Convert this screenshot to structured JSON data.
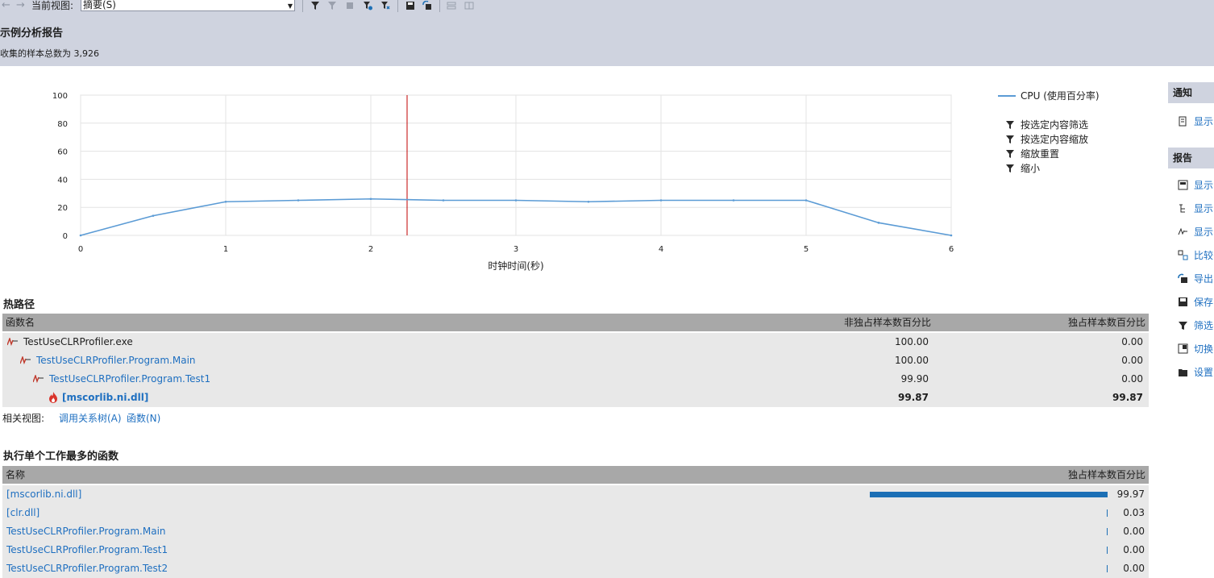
{
  "toolbar": {
    "view_label": "当前视图:",
    "view_value": "摘要(S)"
  },
  "header": {
    "title": "示例分析报告",
    "subtitle": "收集的样本总数为 3,926"
  },
  "chart_data": {
    "type": "line",
    "xlabel": "时钟时间(秒)",
    "ylabel": "",
    "xlim": [
      0,
      6
    ],
    "ylim": [
      0,
      100
    ],
    "x_ticks": [
      0,
      1,
      2,
      3,
      4,
      5,
      6
    ],
    "y_ticks": [
      0,
      20,
      40,
      60,
      80,
      100
    ],
    "grid": true,
    "legend": "right",
    "series": [
      {
        "name": "CPU (使用百分率)",
        "color": "#5b9bd5",
        "x": [
          0,
          0.5,
          1,
          1.5,
          2,
          2.5,
          3,
          3.5,
          4,
          4.5,
          5,
          5.5,
          6
        ],
        "y": [
          0,
          14,
          24,
          25,
          26,
          25,
          25,
          24,
          25,
          25,
          25,
          9,
          0
        ]
      }
    ],
    "marker_line": {
      "x": 2.25,
      "color": "#c00000"
    }
  },
  "legend": {
    "series_label": "CPU (使用百分率)",
    "actions": [
      "按选定内容筛选",
      "按选定内容缩放",
      "缩放重置",
      "缩小"
    ]
  },
  "sidepanel": {
    "notify_header": "通知",
    "notify_items": [
      "显示"
    ],
    "report_header": "报告",
    "report_items": [
      "显示",
      "显示",
      "显示",
      "比较",
      "导出",
      "保存",
      "筛选",
      "切换",
      "设置"
    ]
  },
  "hot_path": {
    "title": "热路径",
    "columns": [
      "函数名",
      "非独占样本数百分比",
      "独占样本数百分比"
    ],
    "rows": [
      {
        "name": "TestUseCLRProfiler.exe",
        "inclusive": "100.00",
        "exclusive": "0.00"
      },
      {
        "name": "TestUseCLRProfiler.Program.Main",
        "inclusive": "100.00",
        "exclusive": "0.00"
      },
      {
        "name": "TestUseCLRProfiler.Program.Test1",
        "inclusive": "99.90",
        "exclusive": "0.00"
      },
      {
        "name": "[mscorlib.ni.dll]",
        "inclusive": "99.87",
        "exclusive": "99.87"
      }
    ]
  },
  "related": {
    "label": "相关视图:",
    "links": [
      "调用关系树(A)",
      "函数(N)"
    ]
  },
  "top_functions": {
    "title": "执行单个工作最多的函数",
    "columns": [
      "名称",
      "独占样本数百分比"
    ],
    "rows": [
      {
        "name": "[mscorlib.ni.dll]",
        "value": "99.97",
        "fraction": 0.9997
      },
      {
        "name": "[clr.dll]",
        "value": "0.03",
        "fraction": 0.0003
      },
      {
        "name": "TestUseCLRProfiler.Program.Main",
        "value": "0.00",
        "fraction": 0
      },
      {
        "name": "TestUseCLRProfiler.Program.Test1",
        "value": "0.00",
        "fraction": 0
      },
      {
        "name": "TestUseCLRProfiler.Program.Test2",
        "value": "0.00",
        "fraction": 0
      }
    ]
  }
}
